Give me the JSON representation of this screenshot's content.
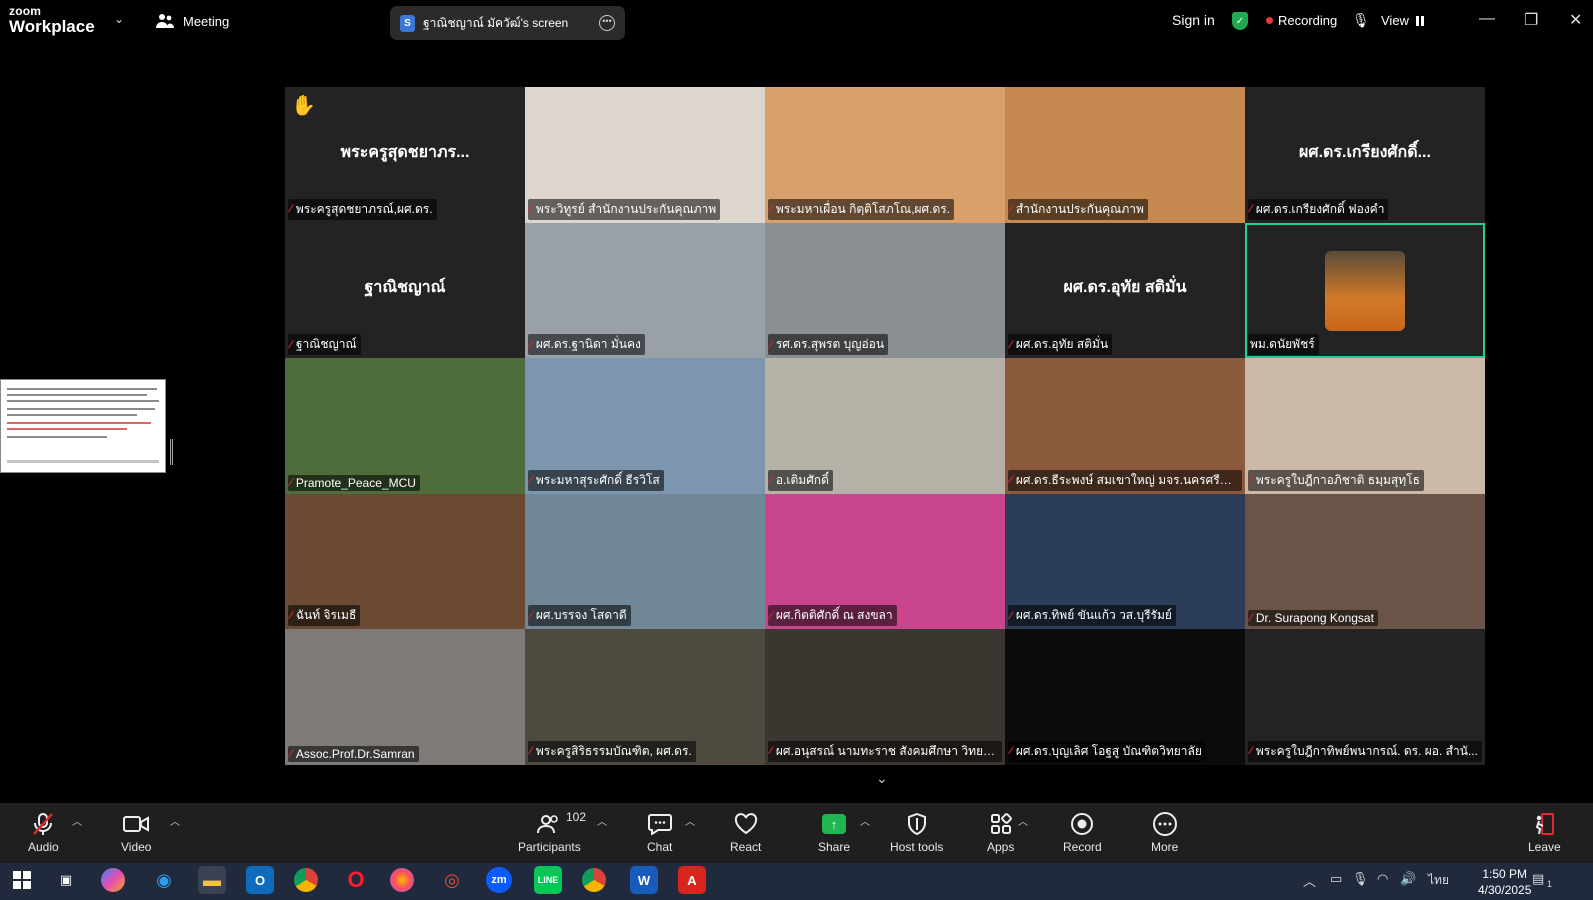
{
  "window": {
    "app_name_small": "zoom",
    "app_name_large": "Workplace",
    "meeting_label": "Meeting",
    "screen_share_label": "ฐาณิชญาณ์ มัควัฒ์'s screen",
    "sign_in": "Sign in",
    "recording_label": "Recording",
    "view_label": "View"
  },
  "tiles": [
    {
      "big": "พระครูสุดชยาภร...",
      "label": "พระครูสุดชยาภรณ์,ผศ.ดร.",
      "raised_hand": true,
      "bg": "#232323"
    },
    {
      "big": "",
      "label": "พระวิทูรย์ สำนักงานประกันคุณภาพ",
      "bg": "#dcd6cf"
    },
    {
      "big": "",
      "label": "พระมหาเผื่อน กิตฺติโสภโณ,ผศ.ดร.",
      "bg": "#d9a06b"
    },
    {
      "big": "",
      "label": "สำนักงานประกันคุณภาพ",
      "bg": "#c68950"
    },
    {
      "big": "ผศ.ดร.เกรียงศักดิ์...",
      "label": "ผศ.ดร.เกรียงศักดิ์ ฟองคำ",
      "bg": "#232323"
    },
    {
      "big": "ฐาณิชญาณ์",
      "label": "ฐาณิชญาณ์",
      "bg": "#232323"
    },
    {
      "big": "",
      "label": "ผศ.ดร.ฐานิดา มั่นคง",
      "bg": "#9aa0a8"
    },
    {
      "big": "",
      "label": "รศ.ดร.สุพรต บุญอ่อน",
      "bg": "#8a8f93"
    },
    {
      "big": "ผศ.ดร.อุทัย สติมั่น",
      "label": "ผศ.ดร.อุทัย สติมั่น",
      "bg": "#232323"
    },
    {
      "big": "",
      "label": "พม.ดนัยพัชร์",
      "bg": "#232323",
      "avatar": true,
      "active": true
    },
    {
      "big": "",
      "label": "Pramote_Peace_MCU",
      "bg": "#4f6d3a"
    },
    {
      "big": "",
      "label": "พระมหาสุระศักดิ์ ธีรวิโส",
      "bg": "#7b96ae"
    },
    {
      "big": "",
      "label": "อ.เติมศักดิ์",
      "bg": "#b7b2a8"
    },
    {
      "big": "",
      "label": "ผศ.ดร.ธีระพงษ์ สมเขาใหญ่ มจร.นครศรีธร...",
      "bg": "#8b5a3c"
    },
    {
      "big": "",
      "label": "พระครูใบฎีกาอภิชาติ ธมฺมสุทฺโธ",
      "bg": "#c9b9a6"
    },
    {
      "big": "",
      "label": "ฉันท์ จิรเมธี",
      "bg": "#6b4a33"
    },
    {
      "big": "",
      "label": "ผศ.บรรจง โสดาดี",
      "bg": "#6f8796"
    },
    {
      "big": "",
      "label": "ผศ.กิตติศักดิ์ ณ สงขลา",
      "bg": "#c9468e"
    },
    {
      "big": "",
      "label": "ผศ.ดร.ทิพย์ ขันแก้ว วส.บุรีรัมย์",
      "bg": "#2b3d58"
    },
    {
      "big": "",
      "label": "Dr. Surapong Kongsat",
      "bg": "#6b5447"
    },
    {
      "big": "",
      "label": "Assoc.Prof.Dr.Samran",
      "bg": "#7d7a77"
    },
    {
      "big": "",
      "label": "พระครูสิริธรรมบัณฑิต, ผศ.ดร.",
      "bg": "#4e4a40"
    },
    {
      "big": "",
      "label": "ผศ.อนุสรณ์ นามทะราช สังคมศึกษา วิทยา...",
      "bg": "#3c3630"
    },
    {
      "big": "",
      "label": "ผศ.ดร.บุญเลิศ โอฐสู บัณฑิตวิทยาลัย",
      "bg": "#0b0b0b"
    },
    {
      "big": "",
      "label": "พระครูใบฎีกาทิพย์พนากรณ์. ดร. ผอ. สำนั...",
      "bg": "#232323"
    }
  ],
  "toolbar": {
    "audio": "Audio",
    "video": "Video",
    "participants": "Participants",
    "participants_count": "102",
    "chat": "Chat",
    "react": "React",
    "share": "Share",
    "host_tools": "Host tools",
    "apps": "Apps",
    "record": "Record",
    "more": "More",
    "leave": "Leave"
  },
  "taskbar": {
    "lang": "ไทย",
    "time": "1:50 PM",
    "date": "4/30/2025",
    "notif": "1",
    "zoom_label": "zm"
  }
}
